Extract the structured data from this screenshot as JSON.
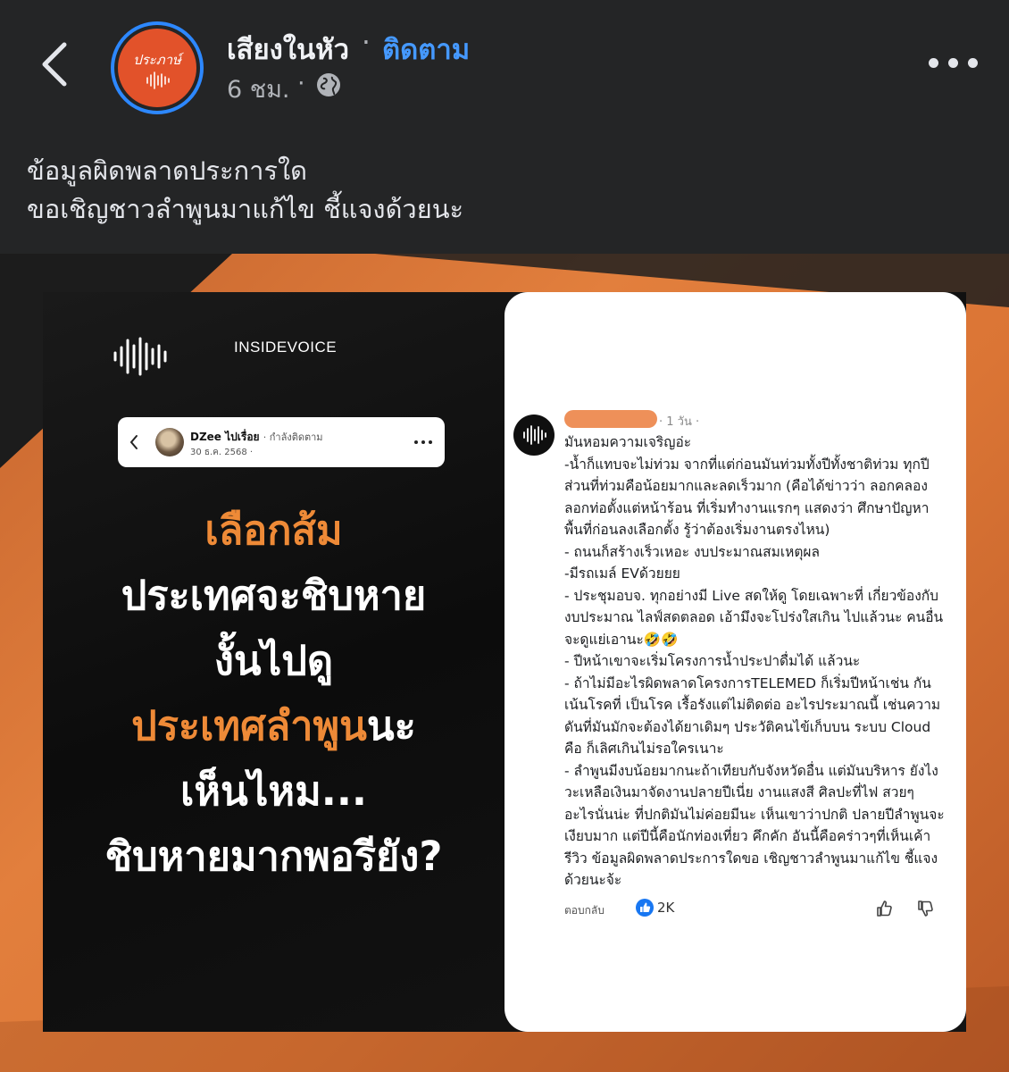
{
  "header": {
    "page_name": "เสียงในหัว",
    "separator": "·",
    "follow_label": "ติดตาม",
    "time": "6 ชม.",
    "meta_separator": "·",
    "avatar_text": "ประภาษ์"
  },
  "caption": {
    "line1": "ข้อมูลผิดพลาดประการใด",
    "line2": "ขอเชิญชาวลำพูนมาแก้ไข ชี้แจงด้วยนะ"
  },
  "image": {
    "brand": "INSIDEVOICE",
    "mini_post": {
      "name": "DZee ไปเรื่อย",
      "follow_status": "· กำลังติดตาม",
      "date": "30 ธ.ค. 2568 ·"
    },
    "headline": [
      "เลือกส้ม",
      "ประเทศจะชิบหาย",
      "งั้นไปดู",
      "ประเทศลำพูนนะ",
      "เห็นไหม...",
      "ชิบหายมากพอรียัง?"
    ],
    "headline_part": {
      "line4_orange": "ประเทศลำพูน",
      "line4_white": "นะ"
    },
    "comment": {
      "time": "· 1 วัน ·",
      "lines": [
        "มันหอมความเจริญอ่ะ",
        "-น้ำก็แทบจะไม่ท่วม จากที่แต่ก่อนมันท่วมทั้งปีทั้งชาติท่วม ทุกปี ส่วนที่ท่วมคือน้อยมากและลดเร็วมาก (คือได้ข่าวว่า ลอกคลองลอกท่อตั้งแต่หน้าร้อน ที่เริ่มทำงานแรกๆ แสดงว่า ศึกษาปัญหาพื้นที่ก่อนลงเลือกตั้ง รู้ว่าต้องเริ่มงานตรงไหน)",
        "- ถนนก็สร้างเร็วเหอะ งบประมาณสมเหตุผล",
        "-มีรถเมล์ EVด้วยยย",
        "- ประชุมอบจ. ทุกอย่างมี Live สดให้ดู โดยเฉพาะที่ เกี่ยวข้องกับงบประมาณ ไลฟ์สดตลอด เอ้ามึงจะโปร่งใสเกิน ไปแล้วนะ คนอื่นจะดูแย่เอานะ🤣🤣",
        "- ปีหน้าเขาจะเริ่มโครงการน้ำประปาดื่มได้ แล้วนะ",
        "- ถ้าไม่มีอะไรผิดพลาดโครงการTELEMED ก็เริ่มปีหน้าเช่น กัน เน้นโรคที่ เป็นโรค เรื้อรังแต่ไม่ติดต่อ อะไรประมาณนี้ เช่นความดันที่มันมักจะต้องได้ยาเดิมๆ ประวัติคนไข้เก็บบน ระบบ Cloud คือ ก็เลิศเกินไม่รอใครเนาะ",
        "- ลำพูนมีงบน้อยมากนะถ้าเทียบกับจังหวัดอื่น แต่มันบริหาร ยังไงวะเหลือเงินมาจัดงานปลายปีเนี่ย งานแสงสี ศิลปะที่ไฟ สวยๆ อะไรนั่นน่ะ ที่ปกติมันไม่ค่อยมีนะ เห็นเขาว่าปกติ ปลายปีลำพูนจะเงียบมาก แต่ปีนี้คือนักท่องเที่ยว คึกคัก อันนี้คือคร่าวๆที่เห็นเค้ารีวิว ข้อมูลผิดพลาดประการใดขอ เชิญชาวลำพูนมาแก้ไข ชี้แจงด้วยนะจ้ะ"
      ],
      "reply_label": "ตอบกลับ",
      "like_count": "2K"
    }
  },
  "colors": {
    "background": "#242526",
    "follow_blue": "#4599ff",
    "avatar_ring": "#2d88ff",
    "avatar_bg": "#e2522a",
    "headline_orange": "#ee8a37",
    "backdrop_orange": "#e27f3d"
  },
  "icons": {
    "back": "chevron-left-icon",
    "globe": "globe-icon",
    "more": "more-horizontal-icon",
    "waveform": "waveform-icon",
    "like": "like-badge-icon",
    "thumb_up": "thumb-up-icon",
    "thumb_down": "thumb-down-icon"
  }
}
